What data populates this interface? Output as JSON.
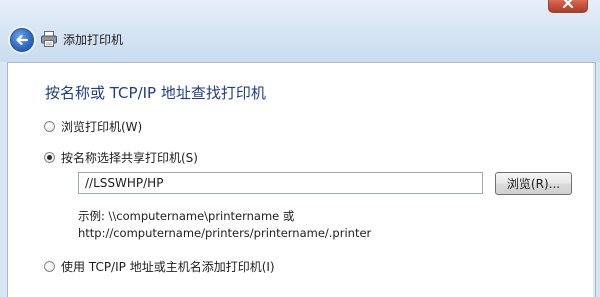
{
  "window": {
    "title": "添加打印机"
  },
  "icons": {
    "close": "close-icon",
    "back": "back-arrow-icon",
    "printer": "printer-icon"
  },
  "page": {
    "heading": "按名称或 TCP/IP 地址查找打印机",
    "options": [
      {
        "label": "浏览打印机(W)",
        "checked": false
      },
      {
        "label": "按名称选择共享打印机(S)",
        "checked": true
      },
      {
        "label": "使用 TCP/IP 地址或主机名添加打印机(I)",
        "checked": false
      }
    ],
    "share_path": {
      "value": "//LSSWHP/HP"
    },
    "browse_label": "浏览(R)...",
    "example_line1": "示例: \\\\computername\\printername 或",
    "example_line2": "http://computername/printers/printername/.printer"
  },
  "colors": {
    "heading": "#1f3e8a",
    "chrome": "#d7e6f5",
    "close_button": "#c0452c"
  }
}
